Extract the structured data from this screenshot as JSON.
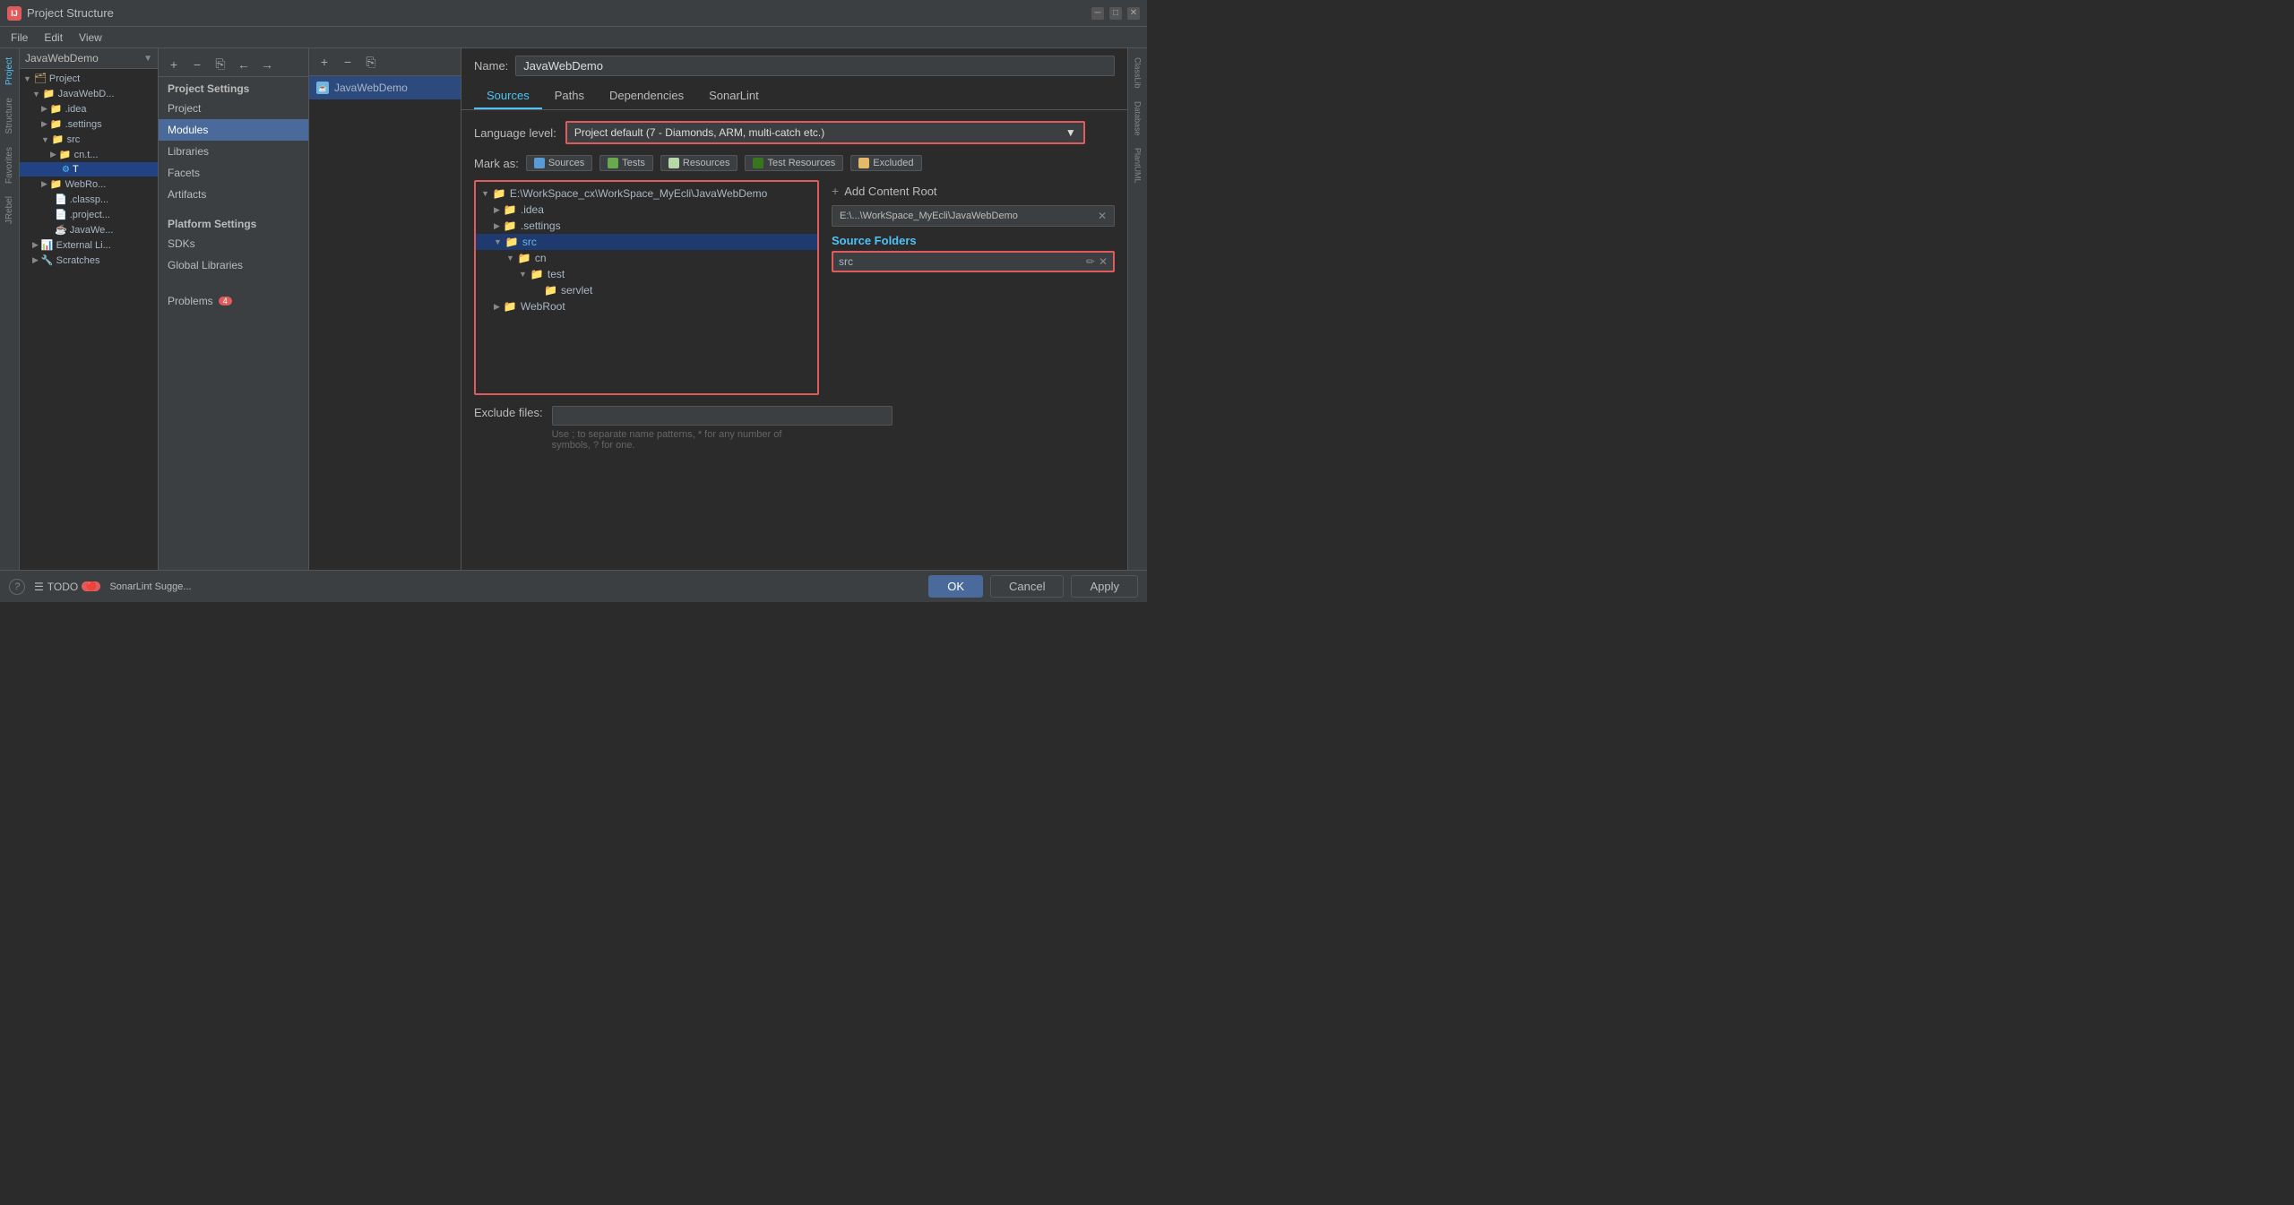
{
  "titlebar": {
    "app_name": "IntelliJ IDEA",
    "window_title": "Project Structure",
    "close_label": "✕",
    "minimize_label": "─",
    "maximize_label": "□"
  },
  "menu": {
    "items": [
      "File",
      "Edit",
      "View"
    ]
  },
  "toolbar": {
    "add_label": "+",
    "remove_label": "−",
    "copy_label": "⎘",
    "back_label": "←",
    "forward_label": "→"
  },
  "project_panel": {
    "header": "JavaWebDemo",
    "breadcrumb": "JavaWebDemo",
    "items": [
      {
        "label": "Project",
        "indent": 0,
        "icon": "folder"
      },
      {
        "label": "JavaWebDemo",
        "indent": 1,
        "icon": "folder-blue"
      },
      {
        "label": ".idea",
        "indent": 2,
        "icon": "folder"
      },
      {
        "label": ".settings",
        "indent": 2,
        "icon": "folder"
      },
      {
        "label": "src",
        "indent": 2,
        "icon": "folder-src"
      },
      {
        "label": "cn.t...",
        "indent": 3,
        "icon": "folder"
      },
      {
        "label": "T",
        "indent": 3,
        "icon": "file",
        "selected": true
      },
      {
        "label": "WebRo...",
        "indent": 2,
        "icon": "folder"
      },
      {
        "label": ".classp...",
        "indent": 2,
        "icon": "file"
      },
      {
        "label": ".project...",
        "indent": 2,
        "icon": "file"
      },
      {
        "label": "JavaWe...",
        "indent": 2,
        "icon": "file"
      },
      {
        "label": "External Li...",
        "indent": 1,
        "icon": "folder"
      },
      {
        "label": "Scratches",
        "indent": 1,
        "icon": "folder"
      }
    ]
  },
  "left_nav": {
    "project_settings_title": "Project Settings",
    "items": [
      {
        "label": "Project"
      },
      {
        "label": "Modules",
        "active": true
      },
      {
        "label": "Libraries"
      },
      {
        "label": "Facets"
      },
      {
        "label": "Artifacts"
      }
    ],
    "platform_settings_title": "Platform Settings",
    "platform_items": [
      {
        "label": "SDKs"
      },
      {
        "label": "Global Libraries"
      }
    ],
    "problems_label": "Problems",
    "problems_count": "4"
  },
  "module_list": {
    "item_label": "JavaWebDemo",
    "item_icon": "J"
  },
  "content": {
    "name_label": "Name:",
    "name_value": "JavaWebDemo",
    "tabs": [
      {
        "label": "Sources",
        "active": true
      },
      {
        "label": "Paths"
      },
      {
        "label": "Dependencies"
      },
      {
        "label": "SonarLint"
      }
    ],
    "language_level_label": "Language level:",
    "language_level_value": "Project default (7 - Diamonds, ARM, multi-catch etc.)",
    "mark_as_label": "Mark as:",
    "mark_buttons": [
      {
        "label": "Sources",
        "color": "blue"
      },
      {
        "label": "Tests",
        "color": "green"
      },
      {
        "label": "Resources",
        "color": "light-green"
      },
      {
        "label": "Test Resources",
        "color": "darker-green"
      },
      {
        "label": "Excluded",
        "color": "orange"
      }
    ],
    "file_tree": {
      "root_path": "E:\\WorkSpace_cx\\WorkSpace_MyEcli\\JavaWebDemo",
      "items": [
        {
          "label": "E:\\WorkSpace_cx\\WorkSpace_MyEcli\\JavaWebDemo",
          "indent": 0,
          "type": "folder-open"
        },
        {
          "label": ".idea",
          "indent": 1,
          "type": "folder"
        },
        {
          "label": ".settings",
          "indent": 1,
          "type": "folder"
        },
        {
          "label": "src",
          "indent": 1,
          "type": "folder-src",
          "selected": true
        },
        {
          "label": "cn",
          "indent": 2,
          "type": "folder"
        },
        {
          "label": "test",
          "indent": 3,
          "type": "folder"
        },
        {
          "label": "servlet",
          "indent": 4,
          "type": "folder"
        },
        {
          "label": "WebRoot",
          "indent": 1,
          "type": "folder"
        }
      ]
    },
    "right_panel": {
      "add_content_root_label": "Add Content Root",
      "content_root_path": "E:\\...\\WorkSpace_MyEcli\\JavaWebDemo",
      "source_folders_label": "Source Folders",
      "source_folder_item": "src"
    },
    "exclude_files_label": "Exclude files:",
    "exclude_hint": "Use ; to separate name patterns, * for any number of\nsymbols, ? for one."
  },
  "bottom": {
    "todo_label": "TODO",
    "sonar_label": "SonarLint Sugge...",
    "error_icon": "🔴",
    "ok_label": "OK",
    "cancel_label": "Cancel",
    "apply_label": "Apply",
    "help_label": "?"
  },
  "right_strip_tabs": [
    "ClassLib",
    "Database",
    "PlantUML"
  ],
  "sidebar_left_tabs": [
    "Project",
    "Structure",
    "Favorites",
    "JRebel"
  ]
}
